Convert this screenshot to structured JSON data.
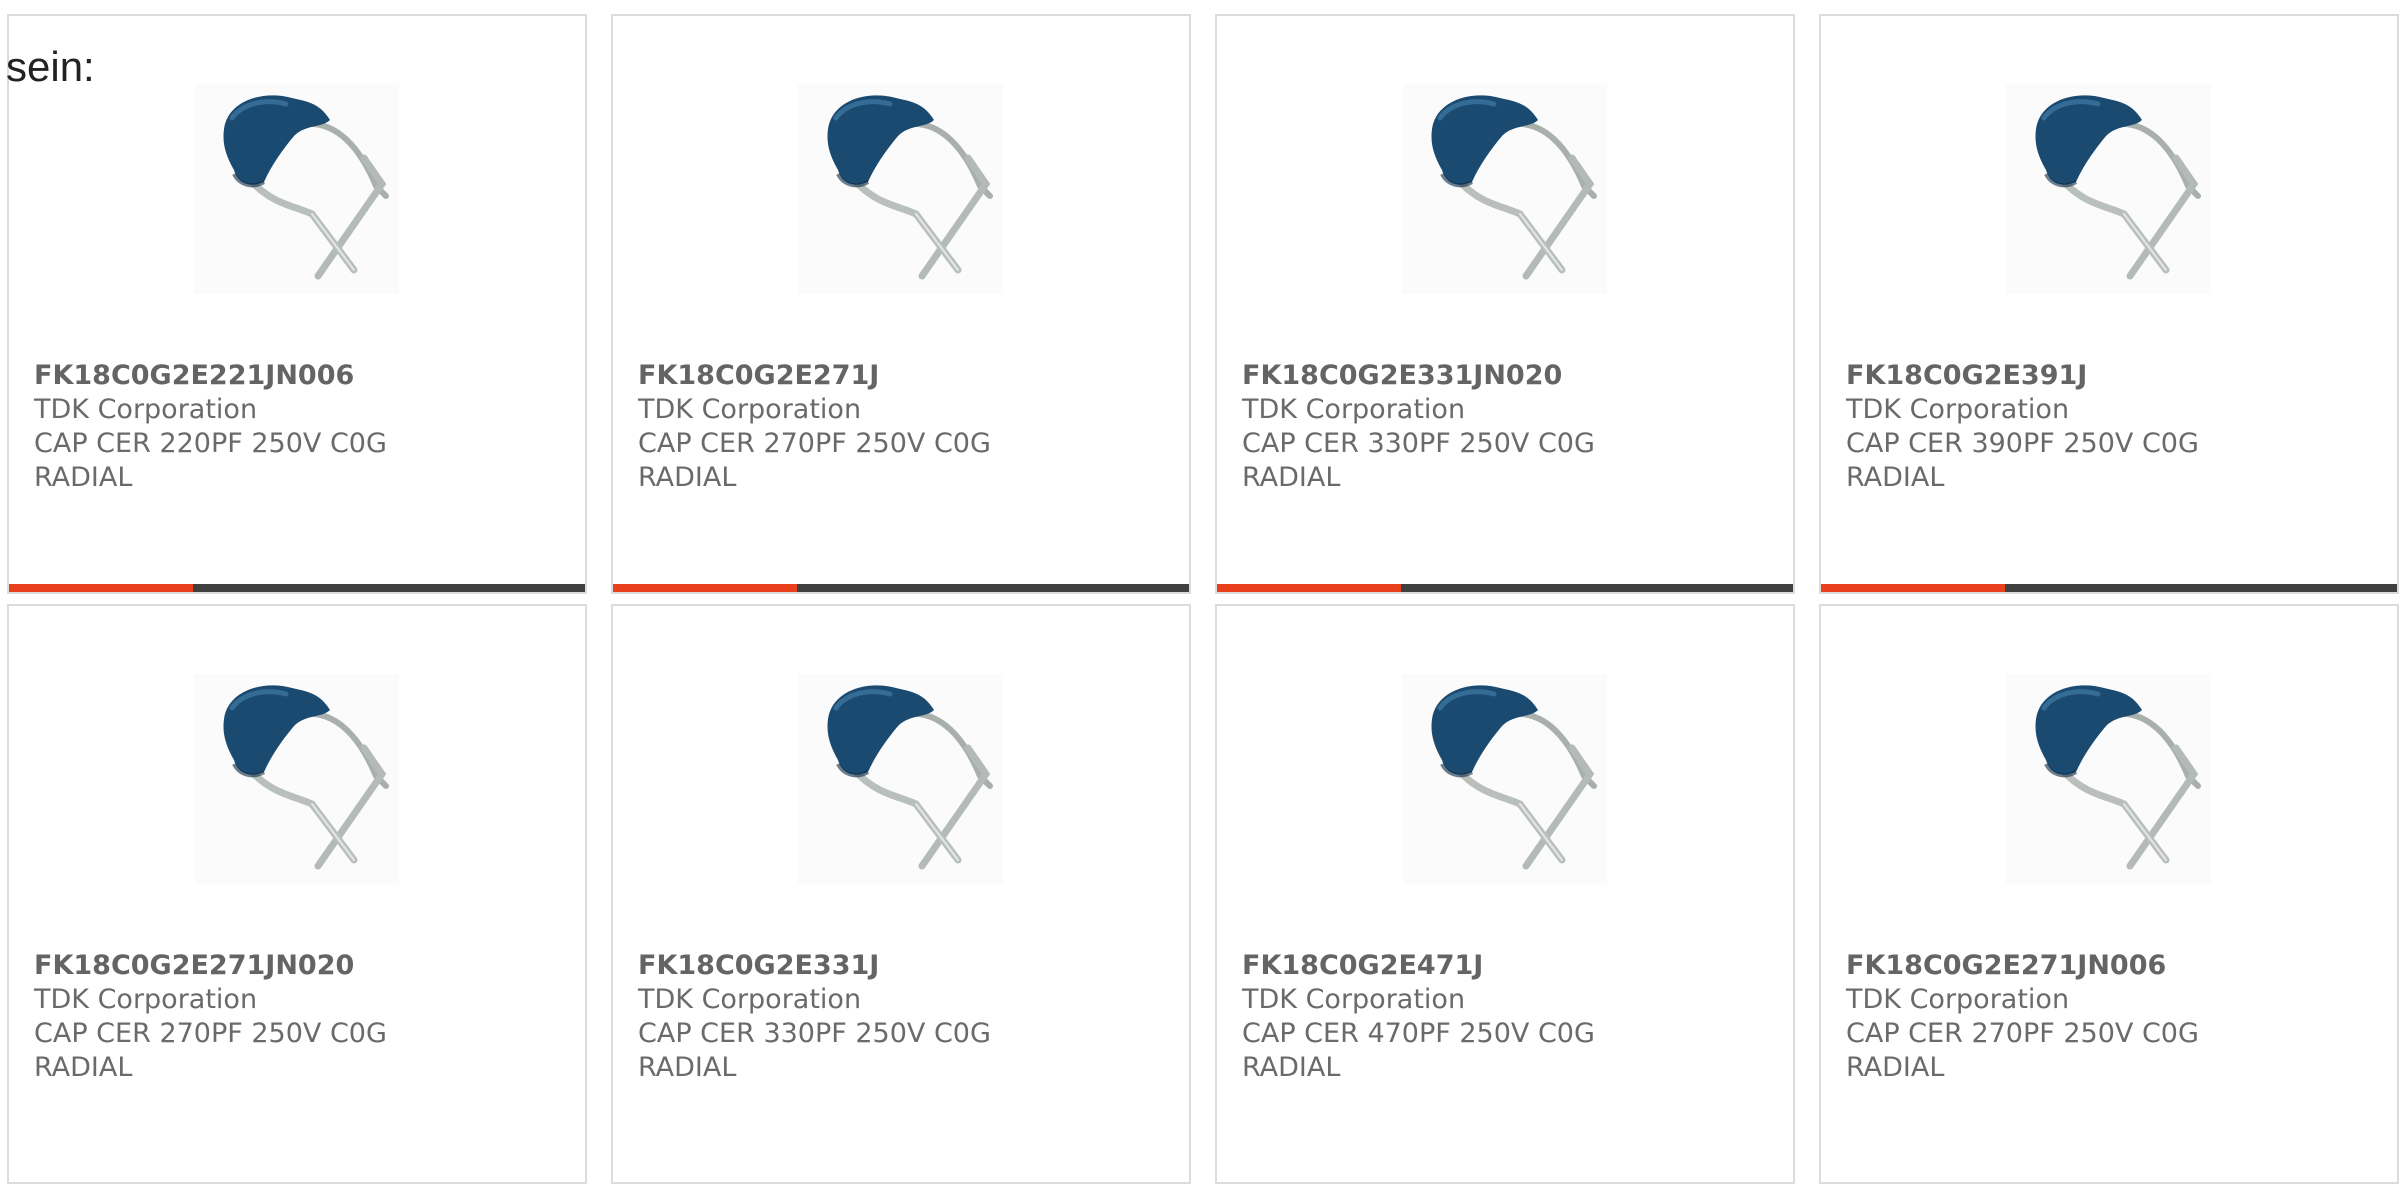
{
  "intro_text": "sein:",
  "accent_color": "#e8401c",
  "bar_track_color": "#404040",
  "products": [
    {
      "part_number": "FK18C0G2E221JN006",
      "manufacturer": "TDK Corporation",
      "desc_line1": "CAP CER 220PF 250V C0G",
      "desc_line2": "RADIAL",
      "image": "radial-ceramic-capacitor-image",
      "progress": 0.32
    },
    {
      "part_number": "FK18C0G2E271J",
      "manufacturer": "TDK Corporation",
      "desc_line1": "CAP CER 270PF 250V C0G",
      "desc_line2": "RADIAL",
      "image": "radial-ceramic-capacitor-image",
      "progress": 0.32
    },
    {
      "part_number": "FK18C0G2E331JN020",
      "manufacturer": "TDK Corporation",
      "desc_line1": "CAP CER 330PF 250V C0G",
      "desc_line2": "RADIAL",
      "image": "radial-ceramic-capacitor-image",
      "progress": 0.32
    },
    {
      "part_number": "FK18C0G2E391J",
      "manufacturer": "TDK Corporation",
      "desc_line1": "CAP CER 390PF 250V C0G",
      "desc_line2": "RADIAL",
      "image": "radial-ceramic-capacitor-image",
      "progress": 0.32
    },
    {
      "part_number": "FK18C0G2E271JN020",
      "manufacturer": "TDK Corporation",
      "desc_line1": "CAP CER 270PF 250V C0G",
      "desc_line2": "RADIAL",
      "image": "radial-ceramic-capacitor-image"
    },
    {
      "part_number": "FK18C0G2E331J",
      "manufacturer": "TDK Corporation",
      "desc_line1": "CAP CER 330PF 250V C0G",
      "desc_line2": "RADIAL",
      "image": "radial-ceramic-capacitor-image"
    },
    {
      "part_number": "FK18C0G2E471J",
      "manufacturer": "TDK Corporation",
      "desc_line1": "CAP CER 470PF 250V C0G",
      "desc_line2": "RADIAL",
      "image": "radial-ceramic-capacitor-image"
    },
    {
      "part_number": "FK18C0G2E271JN006",
      "manufacturer": "TDK Corporation",
      "desc_line1": "CAP CER 270PF 250V C0G",
      "desc_line2": "RADIAL",
      "image": "radial-ceramic-capacitor-image"
    }
  ]
}
